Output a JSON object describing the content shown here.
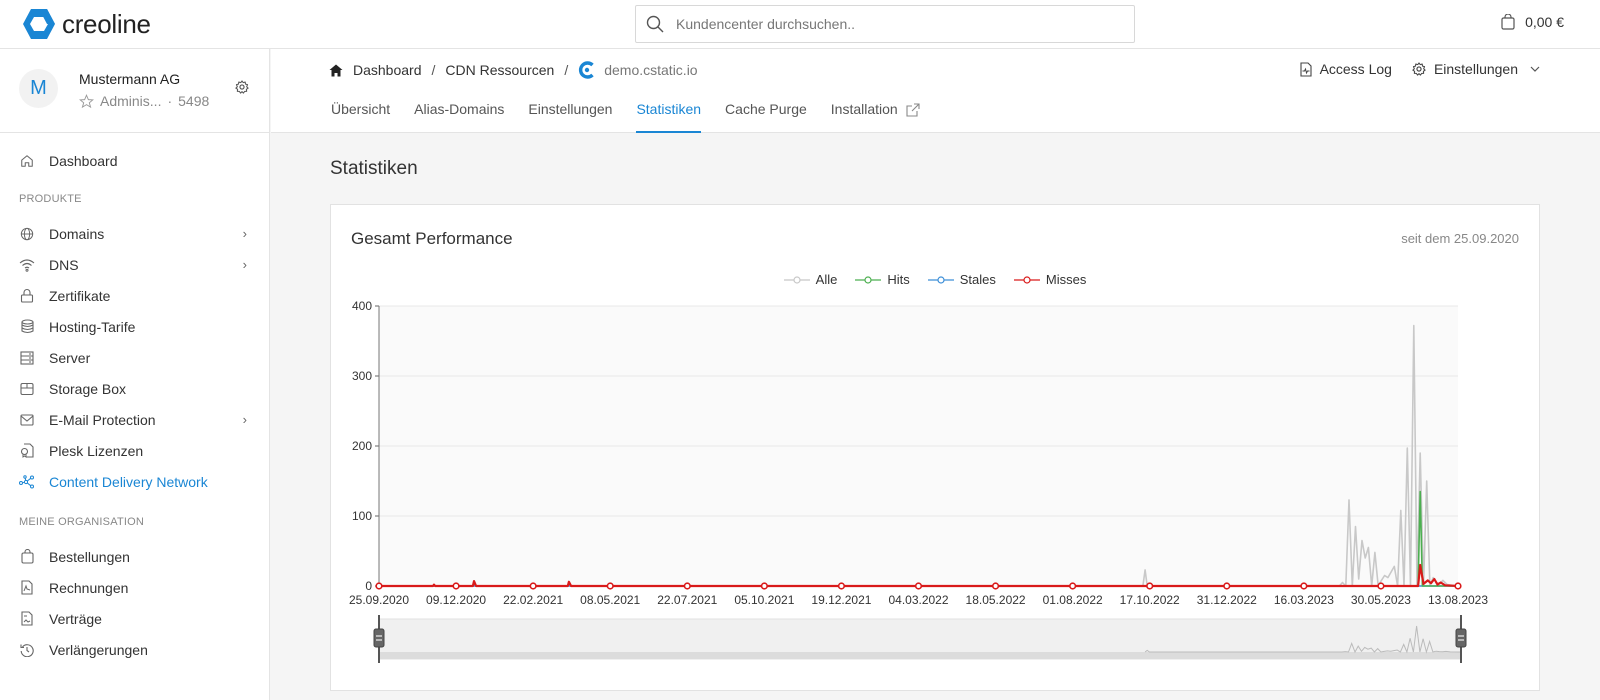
{
  "app": {
    "logo_text": "creoline",
    "brand_color": "#1a86d4"
  },
  "search": {
    "placeholder": "Kundencenter durchsuchen..",
    "value": ""
  },
  "cart": {
    "amount": "0,00 €"
  },
  "account": {
    "initial": "M",
    "name": "Mustermann AG",
    "role": "Adminis...",
    "separator": "·",
    "number": "5498"
  },
  "sidebar": {
    "dashboard": "Dashboard",
    "section_products": "PRODUKTE",
    "products": [
      {
        "label": "Domains",
        "icon": "globe-icon",
        "has_chevron": true
      },
      {
        "label": "DNS",
        "icon": "wifi-icon",
        "has_chevron": true
      },
      {
        "label": "Zertifikate",
        "icon": "lock-icon",
        "has_chevron": false
      },
      {
        "label": "Hosting-Tarife",
        "icon": "database-icon",
        "has_chevron": false
      },
      {
        "label": "Server",
        "icon": "server-icon",
        "has_chevron": false
      },
      {
        "label": "Storage Box",
        "icon": "box-icon",
        "has_chevron": false
      },
      {
        "label": "E-Mail Protection",
        "icon": "mail-icon",
        "has_chevron": true
      },
      {
        "label": "Plesk Lizenzen",
        "icon": "license-icon",
        "has_chevron": false
      },
      {
        "label": "Content Delivery Network",
        "icon": "network-icon",
        "has_chevron": false,
        "active": true
      }
    ],
    "section_org": "MEINE ORGANISATION",
    "org": [
      {
        "label": "Bestellungen",
        "icon": "shopping-bag-icon"
      },
      {
        "label": "Rechnungen",
        "icon": "invoice-icon"
      },
      {
        "label": "Verträge",
        "icon": "contract-icon"
      },
      {
        "label": "Verlängerungen",
        "icon": "history-icon"
      }
    ]
  },
  "breadcrumb": {
    "items": [
      "Dashboard",
      "CDN Ressourcen",
      "demo.cstatic.io"
    ],
    "separator": "/"
  },
  "header_actions": {
    "access_log": "Access Log",
    "settings": "Einstellungen"
  },
  "tabs": [
    {
      "label": "Übersicht"
    },
    {
      "label": "Alias-Domains"
    },
    {
      "label": "Einstellungen"
    },
    {
      "label": "Statistiken",
      "active": true
    },
    {
      "label": "Cache Purge"
    },
    {
      "label": "Installation",
      "external": true
    }
  ],
  "page": {
    "title": "Statistiken"
  },
  "card": {
    "title": "Gesamt Performance",
    "since": "seit dem 25.09.2020"
  },
  "chart_data": {
    "type": "line",
    "title": "Gesamt Performance",
    "xlabel": "",
    "ylabel": "",
    "ylim": [
      0,
      400
    ],
    "yticks": [
      0,
      100,
      200,
      300,
      400
    ],
    "xticks": [
      "25.09.2020",
      "09.12.2020",
      "22.02.2021",
      "08.05.2021",
      "22.07.2021",
      "05.10.2021",
      "19.12.2021",
      "04.03.2022",
      "18.05.2022",
      "01.08.2022",
      "17.10.2022",
      "31.12.2022",
      "16.03.2023",
      "30.05.2023",
      "13.08.2023"
    ],
    "x_range": [
      "25.09.2020",
      "13.08.2023"
    ],
    "grid": true,
    "legend_position": "top-center",
    "series": [
      {
        "name": "Alle",
        "color": "#c8c8c8",
        "points": [
          [
            0.708,
            0
          ],
          [
            0.71,
            23
          ],
          [
            0.712,
            0
          ],
          [
            0.89,
            0
          ],
          [
            0.893,
            5
          ],
          [
            0.896,
            0
          ],
          [
            0.899,
            123
          ],
          [
            0.902,
            0
          ],
          [
            0.905,
            85
          ],
          [
            0.908,
            10
          ],
          [
            0.911,
            65
          ],
          [
            0.914,
            40
          ],
          [
            0.917,
            55
          ],
          [
            0.92,
            0
          ],
          [
            0.923,
            48
          ],
          [
            0.926,
            0
          ],
          [
            0.929,
            8
          ],
          [
            0.932,
            15
          ],
          [
            0.935,
            12
          ],
          [
            0.938,
            20
          ],
          [
            0.941,
            28
          ],
          [
            0.944,
            0
          ],
          [
            0.947,
            108
          ],
          [
            0.95,
            0
          ],
          [
            0.953,
            197
          ],
          [
            0.956,
            0
          ],
          [
            0.959,
            372
          ],
          [
            0.962,
            0
          ],
          [
            0.965,
            190
          ],
          [
            0.968,
            0
          ],
          [
            0.971,
            150
          ],
          [
            0.974,
            0
          ],
          [
            0.977,
            12
          ],
          [
            0.98,
            5
          ],
          [
            0.983,
            3
          ],
          [
            0.986,
            8
          ],
          [
            0.99,
            2
          ],
          [
            1.0,
            0
          ]
        ]
      },
      {
        "name": "Hits",
        "color": "#4caf50",
        "points": [
          [
            0.963,
            0
          ],
          [
            0.965,
            135
          ],
          [
            0.967,
            0
          ],
          [
            1.0,
            0
          ]
        ]
      },
      {
        "name": "Stales",
        "color": "#3d8fd8",
        "points": [
          [
            0.0,
            0
          ],
          [
            1.0,
            0
          ]
        ]
      },
      {
        "name": "Misses",
        "color": "#d91a1a",
        "points": [
          [
            0.0,
            0
          ],
          [
            0.05,
            0
          ],
          [
            0.051,
            2
          ],
          [
            0.052,
            0
          ],
          [
            0.087,
            0
          ],
          [
            0.088,
            7
          ],
          [
            0.09,
            0
          ],
          [
            0.175,
            0
          ],
          [
            0.176,
            6
          ],
          [
            0.178,
            0
          ],
          [
            0.963,
            0
          ],
          [
            0.965,
            30
          ],
          [
            0.968,
            3
          ],
          [
            0.972,
            8
          ],
          [
            0.975,
            4
          ],
          [
            0.978,
            10
          ],
          [
            0.981,
            2
          ],
          [
            0.984,
            5
          ],
          [
            0.988,
            1
          ],
          [
            1.0,
            0
          ]
        ]
      }
    ]
  },
  "navigator": {
    "range_start_fraction": 0,
    "range_end_fraction": 1
  }
}
